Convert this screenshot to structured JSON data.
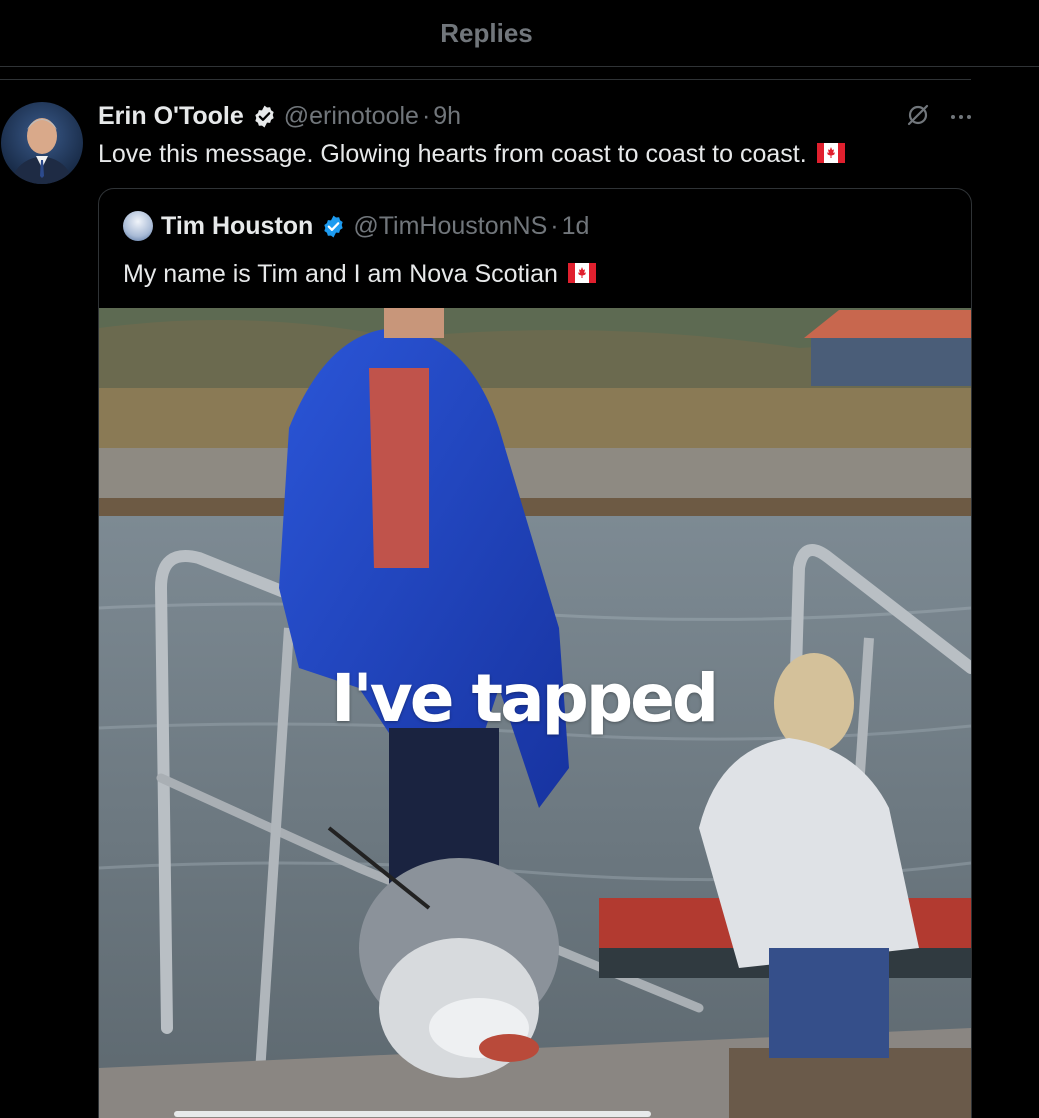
{
  "header": {
    "title": "Replies"
  },
  "tweet": {
    "author_name": "Erin O'Toole",
    "handle": "@erinotoole",
    "separator": "·",
    "time": "9h",
    "text": "Love this message. Glowing hearts from coast to coast to coast.",
    "icons": [
      "grok-icon",
      "more-icon"
    ]
  },
  "quote": {
    "author_name": "Tim Houston",
    "handle": "@TimHoustonNS",
    "separator": "·",
    "time": "1d",
    "text": "My name is Tim and I am Nova Scotian",
    "video_caption": "I've tapped"
  },
  "colors": {
    "background": "#000000",
    "text": "#e7e9ea",
    "muted": "#71767b",
    "verified": "#1d9bf0",
    "border": "#2f3336"
  }
}
